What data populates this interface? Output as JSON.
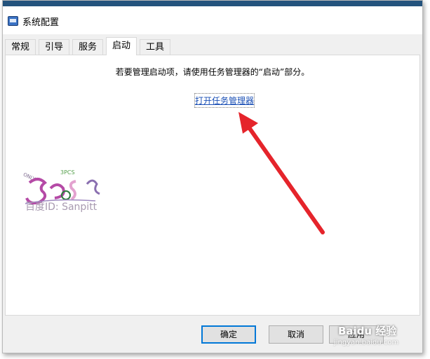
{
  "window": {
    "title": "系统配置"
  },
  "tabs": [
    {
      "label": "常规",
      "active": false
    },
    {
      "label": "引导",
      "active": false
    },
    {
      "label": "服务",
      "active": false
    },
    {
      "label": "启动",
      "active": true
    },
    {
      "label": "工具",
      "active": false
    }
  ],
  "startup": {
    "notice": "若要管理启动项，请使用任务管理器的“启动”部分。",
    "link_label": "打开任务管理器"
  },
  "buttons": {
    "ok": "确定",
    "cancel": "取消",
    "apply": "应用"
  },
  "watermark": {
    "text": "百度ID: Sanpitt",
    "logo_small": "ONLY",
    "logo_small2": "3PCS"
  },
  "overlay": {
    "baidu_brand": "Baidu 经验",
    "baidu_url": "jingyan.baidu.com",
    "arrow_color": "#e5242b"
  },
  "colors": {
    "link": "#1a4fb5",
    "primary_focus": "#0078d7",
    "titlebar_strip": "#24537d"
  }
}
